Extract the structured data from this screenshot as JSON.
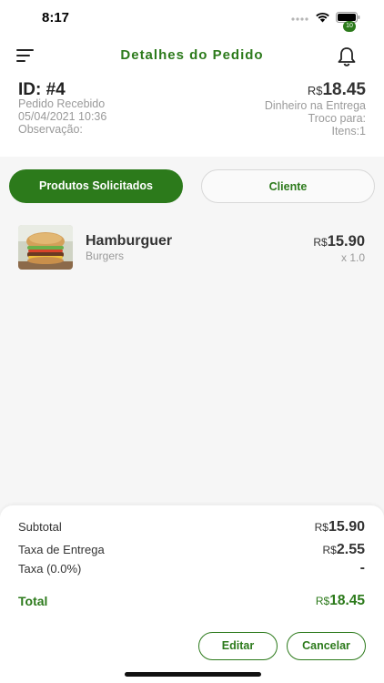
{
  "status_bar": {
    "time": "8:17"
  },
  "header": {
    "title": "Detalhes do Pedido",
    "notification_count": "10"
  },
  "order": {
    "id": "ID: #4",
    "status": "Pedido Recebido",
    "datetime": "05/04/2021 10:36",
    "observation_label": "Observação:",
    "currency": "R$",
    "total": "18.45",
    "payment_method": "Dinheiro na Entrega",
    "change_label": "Troco para:",
    "items_count": "Itens:1"
  },
  "tabs": {
    "products": "Produtos Solicitados",
    "client": "Cliente"
  },
  "products": [
    {
      "name": "Hamburguer",
      "category": "Burgers",
      "currency": "R$",
      "price": "15.90",
      "quantity": "x 1.0"
    }
  ],
  "summary": {
    "subtotal_label": "Subtotal",
    "subtotal_currency": "R$",
    "subtotal_value": "15.90",
    "delivery_label": "Taxa de Entrega",
    "delivery_currency": "R$",
    "delivery_value": "2.55",
    "tax_label": "Taxa (0.0%)",
    "tax_value": "-",
    "total_label": "Total",
    "total_currency": "R$",
    "total_value": "18.45"
  },
  "actions": {
    "edit": "Editar",
    "cancel": "Cancelar"
  },
  "colors": {
    "accent": "#2c7a1b",
    "muted_text": "#9a9a9a",
    "background": "#f6f6f6"
  }
}
